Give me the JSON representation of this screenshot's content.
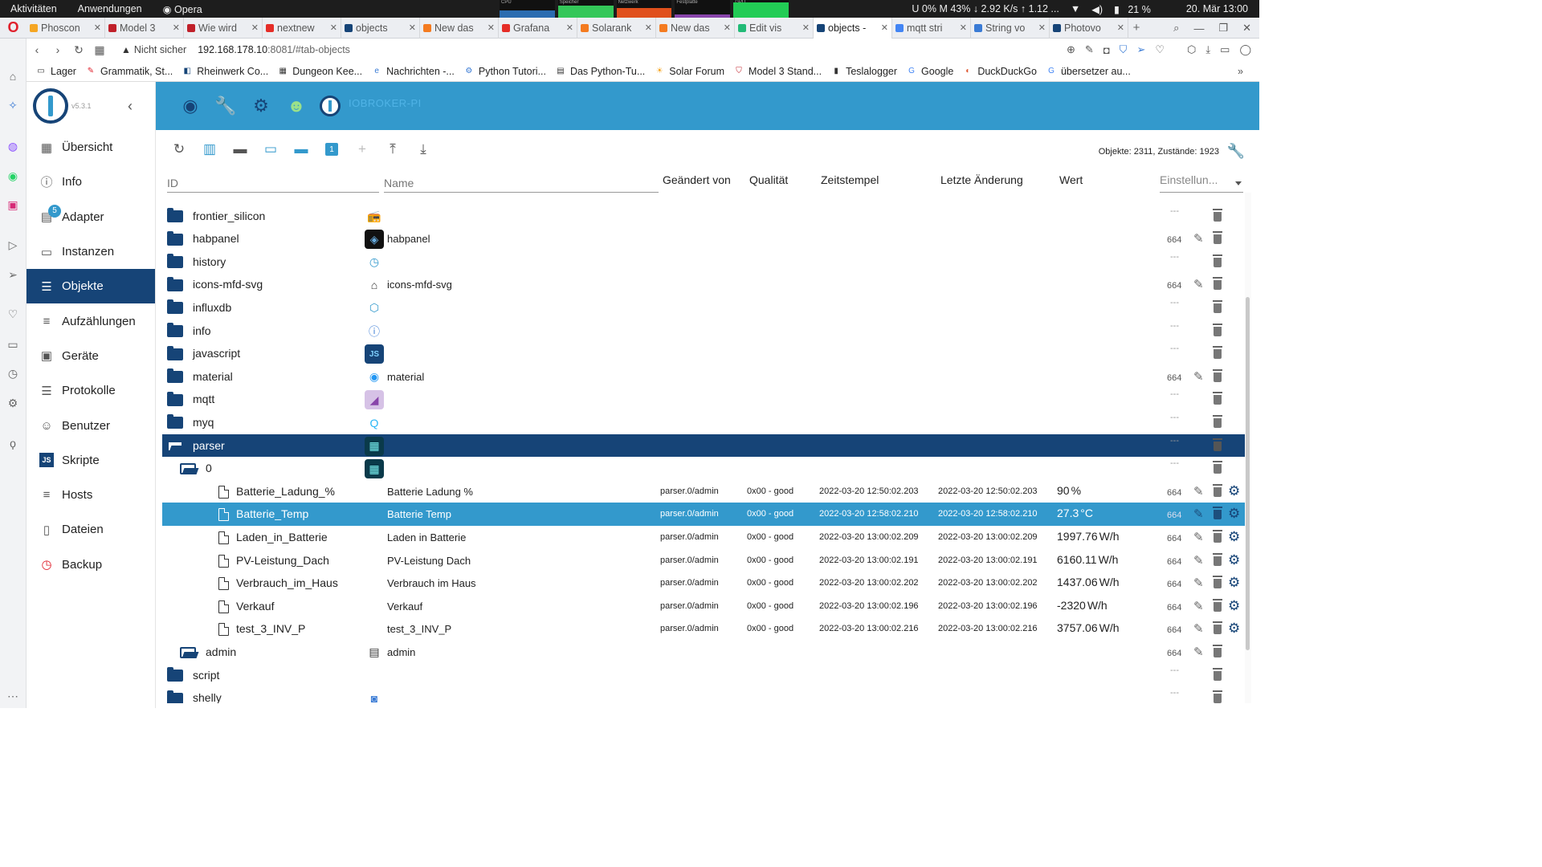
{
  "os_bar": {
    "activities": "Aktivitäten",
    "applications": "Anwendungen",
    "active_app": "Opera",
    "monitors": [
      {
        "caption": "CPU",
        "color": "#2b6cb0"
      },
      {
        "caption": "Speicher",
        "color": "#34c759"
      },
      {
        "caption": "Netzwerk",
        "color": "#e0501c"
      },
      {
        "caption": "Festplatte",
        "color": "#8844aa"
      },
      {
        "caption": "GPU",
        "color": "#22cc55"
      }
    ],
    "stats": "U  0% M  43% ↓ 2.92 K/s ↑ 1.12 ...",
    "battery": "21 %",
    "clock": "20. Mär  13:00"
  },
  "tabs": [
    {
      "label": "Phoscon",
      "color": "#f5a623",
      "active": false
    },
    {
      "label": "Model 3",
      "color": "#c0202a",
      "active": false
    },
    {
      "label": "Wie wird",
      "color": "#c0202a",
      "active": false
    },
    {
      "label": "nextnew",
      "color": "#e52d27",
      "active": false
    },
    {
      "label": "objects",
      "color": "#164477",
      "active": false
    },
    {
      "label": "New das",
      "color": "#f47b20",
      "active": false
    },
    {
      "label": "Grafana",
      "color": "#e52d27",
      "active": false
    },
    {
      "label": "Solarank",
      "color": "#f47b20",
      "active": false
    },
    {
      "label": "New das",
      "color": "#f47b20",
      "active": false
    },
    {
      "label": "Edit vis",
      "color": "#22bb77",
      "active": false
    },
    {
      "label": "objects -",
      "color": "#164477",
      "active": true
    },
    {
      "label": "mqtt stri",
      "color": "#4285f4",
      "active": false
    },
    {
      "label": "String vo",
      "color": "#3a7bd5",
      "active": false
    },
    {
      "label": "Photovo",
      "color": "#164477",
      "active": false
    }
  ],
  "address": {
    "security": "Nicht sicher",
    "host": "192.168.178.10",
    "rest": ":8081/#tab-objects"
  },
  "bookmarks": [
    {
      "label": "Lager",
      "icon": "folder-icon"
    },
    {
      "label": "Grammatik, St...",
      "icon": "grammar-icon"
    },
    {
      "label": "Rheinwerk Co...",
      "icon": "rheinwerk-icon"
    },
    {
      "label": "Dungeon Kee...",
      "icon": "dungeon-icon"
    },
    {
      "label": "Nachrichten -...",
      "icon": "news-icon"
    },
    {
      "label": "Python Tutori...",
      "icon": "python-icon"
    },
    {
      "label": "Das Python-Tu...",
      "icon": "book-icon"
    },
    {
      "label": "Solar Forum",
      "icon": "sun-icon"
    },
    {
      "label": "Model 3 Stand...",
      "icon": "tesla-icon"
    },
    {
      "label": "Teslalogger",
      "icon": "doc-icon"
    },
    {
      "label": "Google",
      "icon": "google-icon"
    },
    {
      "label": "DuckDuckGo",
      "icon": "duckduckgo-icon"
    },
    {
      "label": "übersetzer au...",
      "icon": "google-icon"
    }
  ],
  "app": {
    "version": "v5.3.1",
    "header_title": "IOBROKER-PI",
    "menu": [
      {
        "label": "Übersicht",
        "icon": "grid-icon",
        "active": false
      },
      {
        "label": "Info",
        "icon": "info-icon",
        "active": false
      },
      {
        "label": "Adapter",
        "icon": "store-icon",
        "active": false,
        "badge": "5"
      },
      {
        "label": "Instanzen",
        "icon": "instances-icon",
        "active": false
      },
      {
        "label": "Objekte",
        "icon": "objects-icon",
        "active": true
      },
      {
        "label": "Aufzählungen",
        "icon": "enums-icon",
        "active": false
      },
      {
        "label": "Geräte",
        "icon": "devices-icon",
        "active": false
      },
      {
        "label": "Protokolle",
        "icon": "logs-icon",
        "active": false
      },
      {
        "label": "Benutzer",
        "icon": "user-icon",
        "active": false
      },
      {
        "label": "Skripte",
        "icon": "js-icon",
        "active": false
      },
      {
        "label": "Hosts",
        "icon": "hosts-icon",
        "active": false
      },
      {
        "label": "Dateien",
        "icon": "files-icon",
        "active": false
      },
      {
        "label": "Backup",
        "icon": "backup-icon",
        "active": false
      }
    ],
    "toolbar_one": "1",
    "object_count": "Objekte: 2311, Zustände: 1923",
    "columns": {
      "id_placeholder": "ID",
      "name_placeholder": "Name",
      "changed_by": "Geändert von",
      "quality": "Qualität",
      "timestamp": "Zeitstempel",
      "last_change": "Letzte Änderung",
      "value": "Wert",
      "settings": "Einstellun..."
    }
  },
  "tree": [
    {
      "id": "frontier_silicon",
      "name": "",
      "type": "folder",
      "level": 0,
      "logo": "radio-icon",
      "logo_bg": "#ffffff",
      "acl": "---"
    },
    {
      "id": "habpanel",
      "name": "habpanel",
      "type": "folder",
      "level": 0,
      "logo": "habpanel-icon",
      "logo_bg": "#111111",
      "acl": "664"
    },
    {
      "id": "history",
      "name": "",
      "type": "folder",
      "level": 0,
      "logo": "clock-icon",
      "logo_bg": "#ffffff",
      "acl": "---"
    },
    {
      "id": "icons-mfd-svg",
      "name": "icons-mfd-svg",
      "type": "folder",
      "level": 0,
      "logo": "house-icon",
      "logo_bg": "#ffffff",
      "acl": "664"
    },
    {
      "id": "influxdb",
      "name": "",
      "type": "folder",
      "level": 0,
      "logo": "influx-icon",
      "logo_bg": "#ffffff",
      "acl": "---"
    },
    {
      "id": "info",
      "name": "",
      "type": "folder",
      "level": 0,
      "logo": "info-circle-icon",
      "logo_bg": "#ffffff",
      "acl": "---"
    },
    {
      "id": "javascript",
      "name": "",
      "type": "folder",
      "level": 0,
      "logo": "js-logo-icon",
      "logo_bg": "#164477",
      "acl": "---"
    },
    {
      "id": "material",
      "name": "material",
      "type": "folder",
      "level": 0,
      "logo": "material-icon",
      "logo_bg": "#ffffff",
      "acl": "664"
    },
    {
      "id": "mqtt",
      "name": "",
      "type": "folder",
      "level": 0,
      "logo": "mqtt-icon",
      "logo_bg": "#d6c2e6",
      "acl": "---"
    },
    {
      "id": "myq",
      "name": "",
      "type": "folder",
      "level": 0,
      "logo": "myq-icon",
      "logo_bg": "#ffffff",
      "acl": "---"
    },
    {
      "id": "parser",
      "name": "",
      "type": "folder-open",
      "level": 0,
      "logo": "parser-icon",
      "logo_bg": "#0a3a4a",
      "acl": "---",
      "selected": "dark"
    },
    {
      "id": "0",
      "name": "",
      "type": "folder-open",
      "level": 1,
      "logo": "parser-icon",
      "logo_bg": "#0a3a4a",
      "acl": "---"
    },
    {
      "id": "Batterie_Ladung_%",
      "name": "Batterie Ladung %",
      "type": "state",
      "level": 2,
      "changed_by": "parser.0/admin",
      "quality": "0x00 - good",
      "ts": "2022-03-20 12:50:02.203",
      "lc": "2022-03-20 12:50:02.203",
      "value": "90",
      "unit": "%",
      "acl": "664"
    },
    {
      "id": "Batterie_Temp",
      "name": "Batterie Temp",
      "type": "state",
      "level": 2,
      "changed_by": "parser.0/admin",
      "quality": "0x00 - good",
      "ts": "2022-03-20 12:58:02.210",
      "lc": "2022-03-20 12:58:02.210",
      "value": "27.3",
      "unit": "°C",
      "acl": "664",
      "selected": "light"
    },
    {
      "id": "Laden_in_Batterie",
      "name": "Laden in Batterie",
      "type": "state",
      "level": 2,
      "changed_by": "parser.0/admin",
      "quality": "0x00 - good",
      "ts": "2022-03-20 13:00:02.209",
      "lc": "2022-03-20 13:00:02.209",
      "value": "1997.76",
      "unit": "W/h",
      "acl": "664"
    },
    {
      "id": "PV-Leistung_Dach",
      "name": "PV-Leistung Dach",
      "type": "state",
      "level": 2,
      "changed_by": "parser.0/admin",
      "quality": "0x00 - good",
      "ts": "2022-03-20 13:00:02.191",
      "lc": "2022-03-20 13:00:02.191",
      "value": "6160.11",
      "unit": "W/h",
      "acl": "664"
    },
    {
      "id": "Verbrauch_im_Haus",
      "name": "Verbrauch im Haus",
      "type": "state",
      "level": 2,
      "changed_by": "parser.0/admin",
      "quality": "0x00 - good",
      "ts": "2022-03-20 13:00:02.202",
      "lc": "2022-03-20 13:00:02.202",
      "value": "1437.06",
      "unit": "W/h",
      "acl": "664"
    },
    {
      "id": "Verkauf",
      "name": "Verkauf",
      "type": "state",
      "level": 2,
      "changed_by": "parser.0/admin",
      "quality": "0x00 - good",
      "ts": "2022-03-20 13:00:02.196",
      "lc": "2022-03-20 13:00:02.196",
      "value": "-2320",
      "unit": "W/h",
      "acl": "664"
    },
    {
      "id": "test_3_INV_P",
      "name": "test_3_INV_P",
      "type": "state",
      "level": 2,
      "changed_by": "parser.0/admin",
      "quality": "0x00 - good",
      "ts": "2022-03-20 13:00:02.216",
      "lc": "2022-03-20 13:00:02.216",
      "value": "3757.06",
      "unit": "W/h",
      "acl": "664"
    },
    {
      "id": "admin",
      "name": "admin",
      "type": "folder-open",
      "level": 1,
      "logo": "doc-logo-icon",
      "logo_bg": "#ffffff",
      "acl": "664"
    },
    {
      "id": "script",
      "name": "",
      "type": "folder",
      "level": 0,
      "acl": "---"
    },
    {
      "id": "shelly",
      "name": "",
      "type": "folder",
      "level": 0,
      "logo": "shelly-icon",
      "logo_bg": "#ffffff",
      "acl": "---"
    }
  ]
}
